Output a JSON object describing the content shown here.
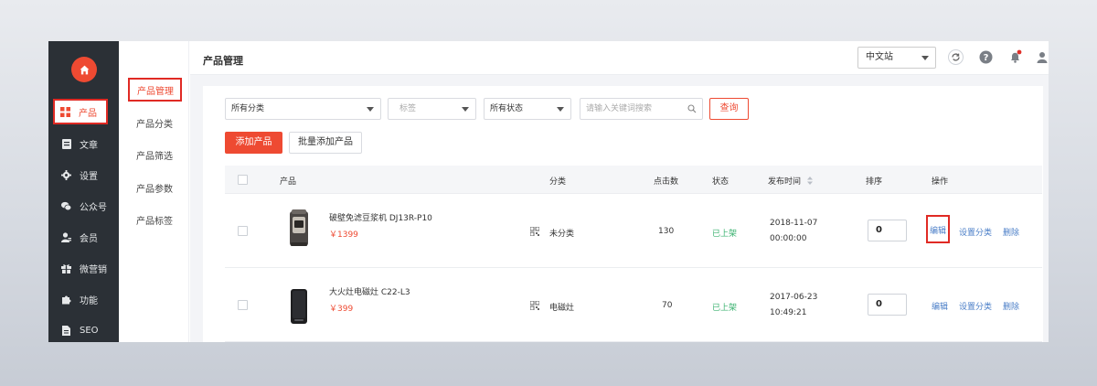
{
  "sidebar": {
    "items": [
      {
        "label": "产品",
        "icon": "grid-icon",
        "active": true
      },
      {
        "label": "文章",
        "icon": "article-icon"
      },
      {
        "label": "设置",
        "icon": "gear-icon"
      },
      {
        "label": "公众号",
        "icon": "wechat-icon"
      },
      {
        "label": "会员",
        "icon": "member-icon"
      },
      {
        "label": "微营销",
        "icon": "gift-icon"
      },
      {
        "label": "功能",
        "icon": "puzzle-icon"
      },
      {
        "label": "SEO",
        "icon": "document-icon"
      }
    ]
  },
  "submenu": {
    "items": [
      {
        "label": "产品管理",
        "active": true
      },
      {
        "label": "产品分类"
      },
      {
        "label": "产品筛选"
      },
      {
        "label": "产品参数"
      },
      {
        "label": "产品标签"
      }
    ]
  },
  "header": {
    "title": "产品管理",
    "site_select": "中文站"
  },
  "filters": {
    "category": "所有分类",
    "tag_placeholder": "标签",
    "status": "所有状态",
    "search_placeholder": "请输入关键词搜索",
    "query_label": "查询"
  },
  "actions": {
    "add": "添加产品",
    "batch_add": "批量添加产品"
  },
  "table": {
    "headers": {
      "product": "产品",
      "category": "分类",
      "clicks": "点击数",
      "status": "状态",
      "publish_time": "发布时间",
      "sort": "排序",
      "operations": "操作"
    },
    "rows": [
      {
        "name": "破壁免滤豆浆机 DJ13R-P10",
        "price": "￥1399",
        "category": "未分类",
        "clicks": "130",
        "status": "已上架",
        "date": "2018-11-07",
        "time": "00:00:00",
        "sort": "0",
        "edit": "编辑",
        "set_category": "设置分类",
        "delete": "删除"
      },
      {
        "name": "大火灶电磁灶 C22-L3",
        "price": "￥399",
        "category": "电磁灶",
        "clicks": "70",
        "status": "已上架",
        "date": "2017-06-23",
        "time": "10:49:21",
        "sort": "0",
        "edit": "编辑",
        "set_category": "设置分类",
        "delete": "删除"
      }
    ]
  },
  "colors": {
    "accent": "#ee4a32",
    "sidebar_bg": "#2b3036",
    "link": "#4a7ec7",
    "status_green": "#3cb371",
    "highlight_box": "#e02a24"
  }
}
